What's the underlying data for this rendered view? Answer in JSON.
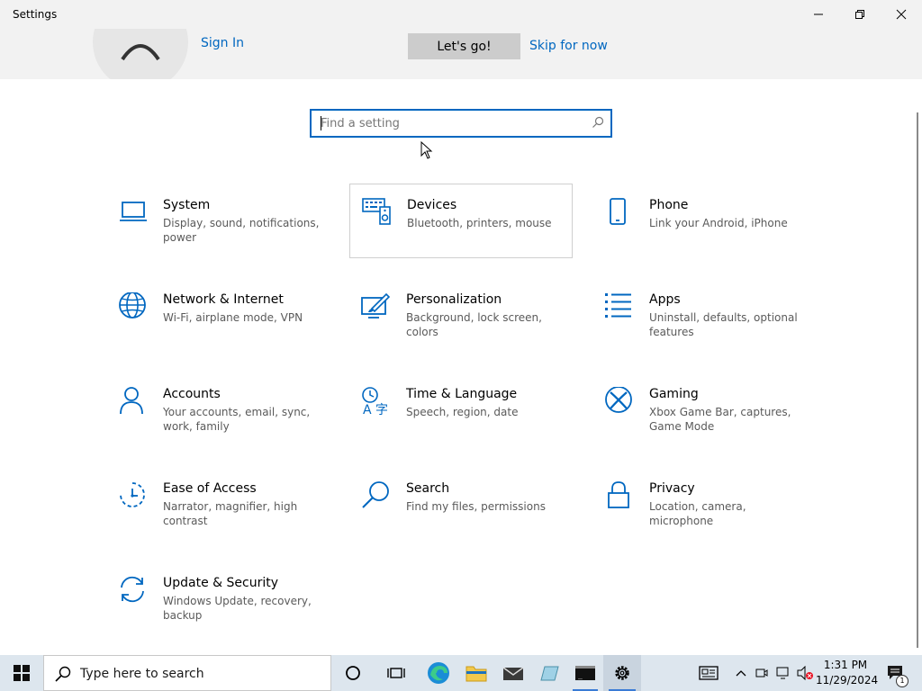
{
  "window": {
    "title": "Settings"
  },
  "banner": {
    "sign_in": "Sign In",
    "lets_go": "Let's go!",
    "skip": "Skip for now"
  },
  "search": {
    "placeholder": "Find a setting",
    "value": ""
  },
  "tiles": [
    {
      "title": "System",
      "desc": "Display, sound, notifications, power",
      "icon": "laptop-icon"
    },
    {
      "title": "Devices",
      "desc": "Bluetooth, printers, mouse",
      "icon": "keyboard-speaker-icon"
    },
    {
      "title": "Phone",
      "desc": "Link your Android, iPhone",
      "icon": "phone-icon"
    },
    {
      "title": "Network & Internet",
      "desc": "Wi-Fi, airplane mode, VPN",
      "icon": "globe-icon"
    },
    {
      "title": "Personalization",
      "desc": "Background, lock screen, colors",
      "icon": "paint-brush-icon"
    },
    {
      "title": "Apps",
      "desc": "Uninstall, defaults, optional features",
      "icon": "apps-list-icon"
    },
    {
      "title": "Accounts",
      "desc": "Your accounts, email, sync, work, family",
      "icon": "person-icon"
    },
    {
      "title": "Time & Language",
      "desc": "Speech, region, date",
      "icon": "time-language-icon"
    },
    {
      "title": "Gaming",
      "desc": "Xbox Game Bar, captures, Game Mode",
      "icon": "xbox-icon"
    },
    {
      "title": "Ease of Access",
      "desc": "Narrator, magnifier, high contrast",
      "icon": "ease-of-access-icon"
    },
    {
      "title": "Search",
      "desc": "Find my files, permissions",
      "icon": "search-icon"
    },
    {
      "title": "Privacy",
      "desc": "Location, camera, microphone",
      "icon": "lock-icon"
    },
    {
      "title": "Update & Security",
      "desc": "Windows Update, recovery, backup",
      "icon": "sync-icon"
    }
  ],
  "taskbar": {
    "search_label": "Type here to search",
    "time": "1:31 PM",
    "date": "11/29/2024",
    "notification_count": "1"
  },
  "colors": {
    "accent": "#0067c0",
    "titlebar_bg": "#f2f2f2",
    "taskbar_bg": "#dde6ee"
  }
}
